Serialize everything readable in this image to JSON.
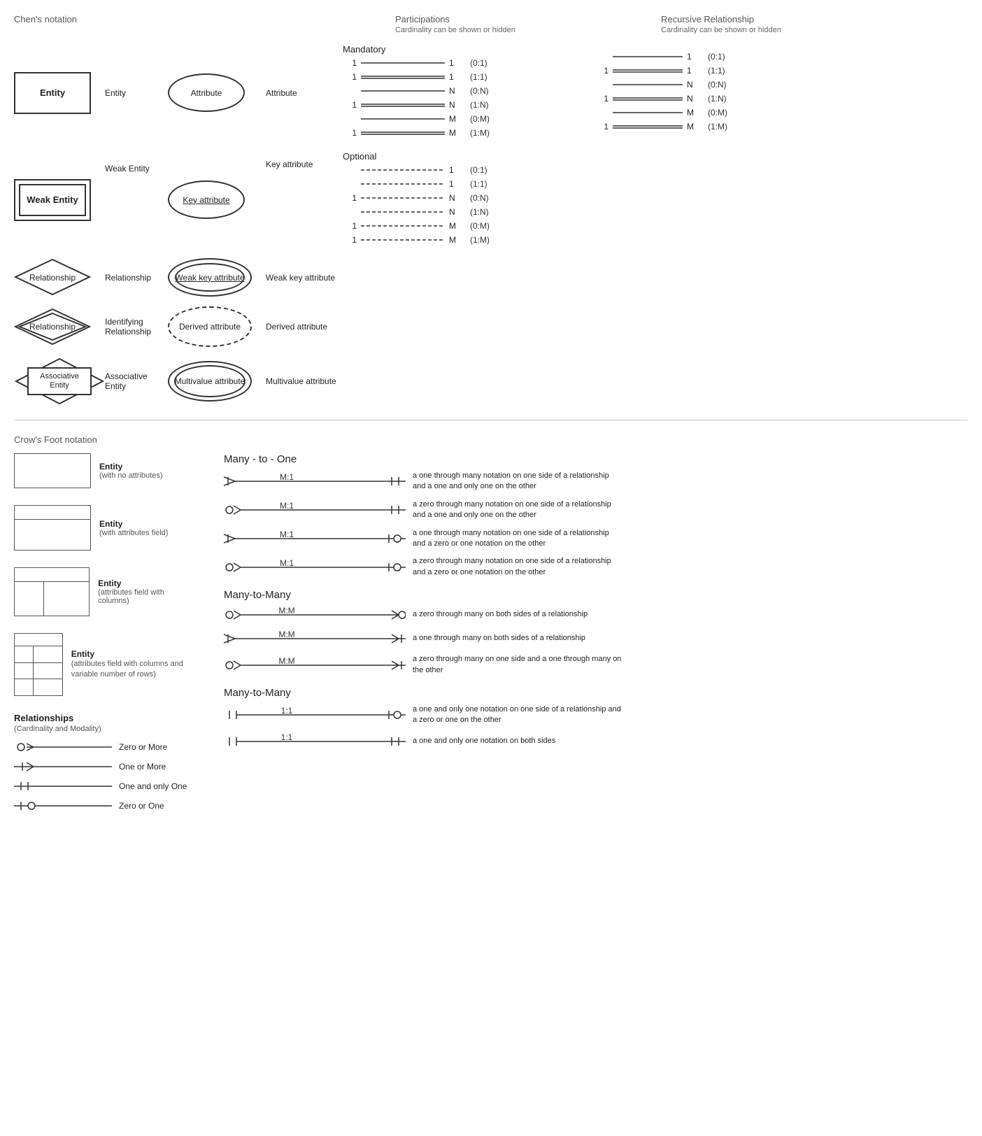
{
  "chens_notation_label": "Chen's notation",
  "participations_label": "Participations",
  "participations_sublabel": "Cardinality can be shown or hidden",
  "recursive_label": "Recursive Relationship",
  "recursive_sublabel": "Cardinality can be shown or hidden",
  "crows_foot_label": "Crow's Foot notation",
  "chens_shapes": [
    {
      "id": "entity",
      "label": "Entity",
      "desc": "Entity"
    },
    {
      "id": "weak-entity",
      "label": "Weak Entity",
      "desc": "Weak Entity"
    },
    {
      "id": "relationship",
      "label": "Relationship",
      "desc": "Relationship"
    },
    {
      "id": "id-relationship",
      "label": "Relationship",
      "desc": "Identifying Relationship"
    },
    {
      "id": "assoc-entity",
      "label": "Associative\nEntity",
      "desc": "Associative Entity"
    }
  ],
  "chens_attrs": [
    {
      "id": "attribute",
      "label": "Attribute",
      "desc": "Attribute"
    },
    {
      "id": "key-attr",
      "label": "Key attribute",
      "desc": "Key attribute"
    },
    {
      "id": "weak-key-attr",
      "label": "Weak key attribute",
      "desc": "Weak key attribute"
    },
    {
      "id": "derived-attr",
      "label": "Derived attribute",
      "desc": "Derived attribute"
    },
    {
      "id": "multivalue-attr",
      "label": "Multivalue attribute",
      "desc": "Multivalue attribute"
    }
  ],
  "mandatory_label": "Mandatory",
  "optional_label": "Optional",
  "mandatory_rows": [
    {
      "left": "1",
      "right": "1",
      "notation": "(0:1)"
    },
    {
      "left": "1",
      "right": "1",
      "notation": "(1:1)"
    },
    {
      "left": "",
      "right": "N",
      "notation": "(0:N)"
    },
    {
      "left": "1",
      "right": "N",
      "notation": "(1:N)"
    },
    {
      "left": "",
      "right": "M",
      "notation": "(0:M)"
    },
    {
      "left": "1",
      "right": "M",
      "notation": "(1:M)"
    }
  ],
  "optional_rows": [
    {
      "left": "",
      "right": "1",
      "notation": "(0:1)"
    },
    {
      "left": "",
      "right": "1",
      "notation": "(1:1)"
    },
    {
      "left": "1",
      "right": "N",
      "notation": "(0:N)"
    },
    {
      "left": "",
      "right": "N",
      "notation": "(1:N)"
    },
    {
      "left": "1",
      "right": "M",
      "notation": "(0:M)"
    },
    {
      "left": "1",
      "right": "M",
      "notation": "(1:M)"
    }
  ],
  "recursive_mandatory_rows": [
    {
      "left": "",
      "right": "1",
      "notation": "(0:1)"
    },
    {
      "left": "1",
      "right": "1",
      "notation": "(1:1)"
    },
    {
      "left": "",
      "right": "N",
      "notation": "(0:N)"
    },
    {
      "left": "1",
      "right": "N",
      "notation": "(1:N)"
    },
    {
      "left": "",
      "right": "M",
      "notation": "(0:M)"
    },
    {
      "left": "1",
      "right": "M",
      "notation": "(1:M)"
    }
  ],
  "cf_entities": [
    {
      "id": "simple",
      "type": "simple",
      "label": "Entity",
      "sublabel": "(with no attributes)"
    },
    {
      "id": "attrs",
      "type": "attrs",
      "label": "Entity",
      "sublabel": "(with attributes field)"
    },
    {
      "id": "cols",
      "type": "cols",
      "label": "Entity",
      "sublabel": "(attributes field with columns)"
    },
    {
      "id": "vrows",
      "type": "vrows",
      "label": "Entity",
      "sublabel": "(attributes field with columns and variable number of rows)"
    }
  ],
  "relationships_section_label": "Relationships",
  "relationships_section_sublabel": "(Cardinality and Modality)",
  "rel_symbols": [
    {
      "id": "zero-or-more",
      "symbol": "zero-or-more",
      "label": "Zero or More"
    },
    {
      "id": "one-or-more",
      "symbol": "one-or-more",
      "label": "One or More"
    },
    {
      "id": "one-and-only-one",
      "symbol": "one-and-only-one",
      "label": "One and only One"
    },
    {
      "id": "zero-or-one",
      "symbol": "zero-or-one",
      "label": "Zero or One"
    }
  ],
  "many_to_one_label": "Many - to - One",
  "many_to_many_label": "Many-to-Many",
  "many_to_many2_label": "Many-to-Many",
  "m_to_1_rows": [
    {
      "ratio": "M:1",
      "left": "crow-one-or-more",
      "right": "one-and-only-one",
      "desc": "a one through many notation on one side of a relationship and a one and only one on the other"
    },
    {
      "ratio": "M:1",
      "left": "crow-zero-or-more",
      "right": "one-and-only-one",
      "desc": "a zero through many notation on one side of a relationship and a one and only one on the other"
    },
    {
      "ratio": "M:1",
      "left": "crow-one-or-more",
      "right": "zero-or-one",
      "desc": "a one through many notation on one side of a relationship and a zero or one notation on the other"
    },
    {
      "ratio": "M:1",
      "left": "crow-zero-or-more",
      "right": "zero-or-one",
      "desc": "a zero through many notation on one side of a relationship and a zero or one notation on the other"
    }
  ],
  "m_to_m_rows": [
    {
      "ratio": "M:M",
      "left": "crow-zero-or-more",
      "right": "crow-zero-or-more-r",
      "desc": "a zero through many on both sides of a relationship"
    },
    {
      "ratio": "M:M",
      "left": "crow-one-or-more",
      "right": "crow-one-or-more-r",
      "desc": "a one through many on both sides of a relationship"
    },
    {
      "ratio": "M:M",
      "left": "crow-zero-or-more",
      "right": "crow-one-or-more-r",
      "desc": "a zero through many on one side and a one through many on the other"
    }
  ],
  "one_to_one_rows": [
    {
      "ratio": "1:1",
      "left": "one-and-only-one",
      "right": "zero-or-one",
      "desc": "a one and only one notation on one side of a relationship and a zero or one on the other"
    },
    {
      "ratio": "1:1",
      "left": "one-and-only-one",
      "right": "one-and-only-one",
      "desc": "a one and only one notation on both sides"
    }
  ]
}
